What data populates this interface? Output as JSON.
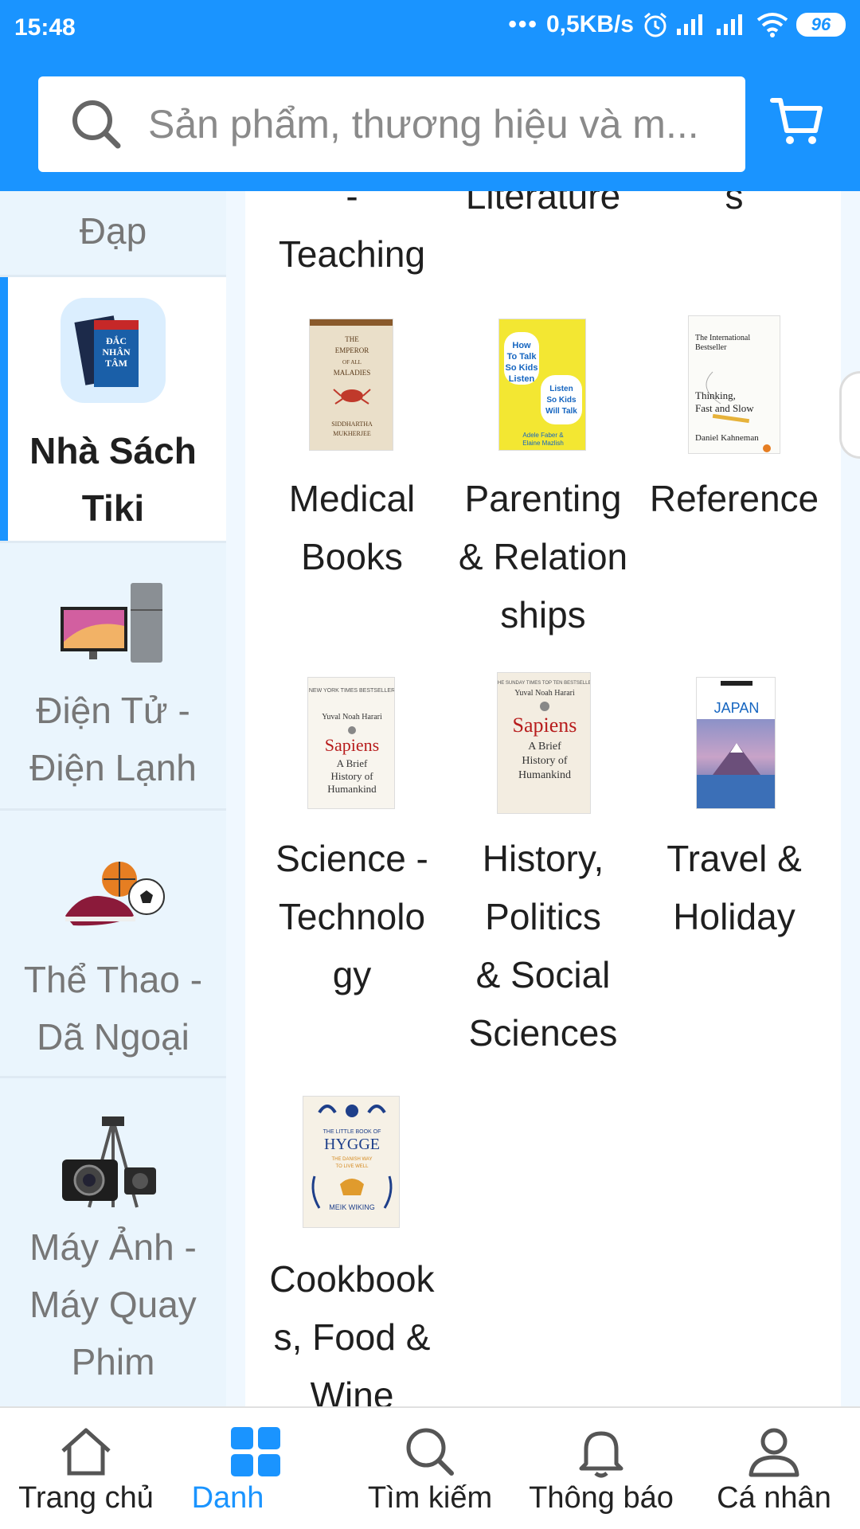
{
  "status_bar": {
    "time": "15:48",
    "dots": "•••",
    "speed": "0,5KB/s",
    "battery": "96"
  },
  "search": {
    "placeholder": "Sản phẩm, thương hiệu và m..."
  },
  "sidebar": {
    "items": [
      {
        "label": "Đạp",
        "icon": "bike-icon"
      },
      {
        "label_line1": "Nhà Sách",
        "label_line2": "Tiki",
        "icon": "books-icon",
        "active": true
      },
      {
        "label_line1": "Điện Tử -",
        "label_line2": "Điện Lạnh",
        "icon": "tv-fridge-icon"
      },
      {
        "label_line1": "Thể Thao -",
        "label_line2": "Dã Ngoại",
        "icon": "sports-icon"
      },
      {
        "label_line1": "Máy Ảnh -",
        "label_line2": "Máy Quay",
        "label_line3": "Phim",
        "icon": "camera-icon"
      }
    ]
  },
  "categories": {
    "top_row": {
      "col1_line1": "-",
      "col1_line2": "Teaching",
      "col2": "Literature",
      "col3": "s"
    },
    "items": [
      {
        "line1": "Medical",
        "line2": "Books",
        "cover_title": "The Emperor of All Maladies",
        "cover_author": "Siddhartha Mukherjee"
      },
      {
        "line1": "Parenting",
        "line2": "& Relation",
        "line3": "ships",
        "cover_title": "How To Talk So Kids Will Listen & Listen So Kids Will Talk",
        "cover_author": "Adele Faber & Elaine Mazlish"
      },
      {
        "line1": "Reference",
        "cover_title": "Thinking, Fast and Slow",
        "cover_author": "Daniel Kahneman",
        "cover_top": "The International Bestseller"
      },
      {
        "line1": "Science -",
        "line2": "Technolo",
        "line3": "gy",
        "cover_title": "Sapiens",
        "cover_sub": "A Brief History of Humankind",
        "cover_author": "Yuval Noah Harari"
      },
      {
        "line1": "History,",
        "line2": "Politics",
        "line3": "& Social",
        "line4": "Sciences",
        "cover_title": "Sapiens",
        "cover_sub": "A Brief History of Humankind",
        "cover_author": "Yuval Noah Harari"
      },
      {
        "line1": "Travel &",
        "line2": "Holiday",
        "cover_title": "JAPAN"
      },
      {
        "line1": "Cookbook",
        "line2": "s, Food &",
        "line3": "Wine",
        "cover_title": "HYGGE",
        "cover_top": "THE LITTLE BOOK OF",
        "cover_sub": "THE DANISH WAY TO LIVE WELL",
        "cover_author": "MEIK WIKING"
      }
    ]
  },
  "bottom_nav": {
    "items": [
      {
        "label": "Trang chủ",
        "icon": "home-icon"
      },
      {
        "label": "Danh",
        "icon": "category-grid-icon",
        "active": true
      },
      {
        "label": "Tìm kiếm",
        "icon": "search-icon"
      },
      {
        "label": "Thông báo",
        "icon": "bell-icon"
      },
      {
        "label": "Cá nhân",
        "icon": "user-icon"
      }
    ]
  },
  "colors": {
    "brand": "#1a94ff",
    "sidebar_bg": "#eaf5fd",
    "text": "#1f1f1f",
    "muted": "#777777"
  }
}
